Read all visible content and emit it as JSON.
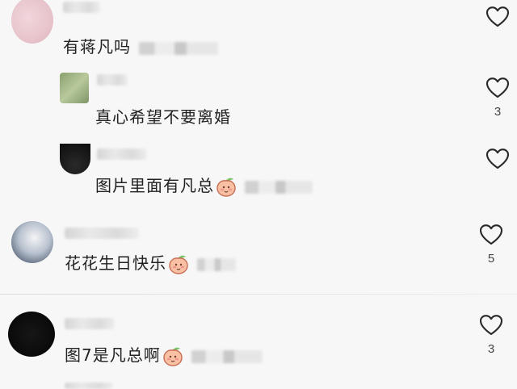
{
  "icons": {
    "like": "heart-outline-icon",
    "emoji": "peach-face-emoji-icon"
  },
  "comments": [
    {
      "text": "有蒋凡吗",
      "like_count": ""
    },
    {
      "text": "真心希望不要离婚",
      "like_count": "3"
    },
    {
      "text": "图片里面有凡总",
      "like_count": ""
    },
    {
      "text": "花花生日快乐",
      "like_count": "5"
    },
    {
      "text": "图7是凡总啊",
      "like_count": "3"
    }
  ]
}
